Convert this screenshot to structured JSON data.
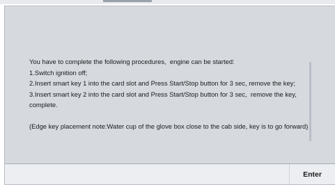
{
  "dialog": {
    "message": "You have to complete the following procedures,  engine can be started:\n1.Switch ignition off;\n2.Insert smart key 1 into the card slot and Press Start/Stop button for 3 sec, remove the key;\n3.Insert smart key 2 into the card slot and Press Start/Stop button for 3 sec,  remove the key, complete.\n\n(Edge key placement note:Water cup of the glove box close to the cab side, key is to go forward)"
  },
  "buttons": {
    "enter_label": "Enter"
  },
  "colors": {
    "dialog_background": "#d6d9de",
    "button_bar_background": "#eceef1",
    "text": "#1b1b1b"
  }
}
